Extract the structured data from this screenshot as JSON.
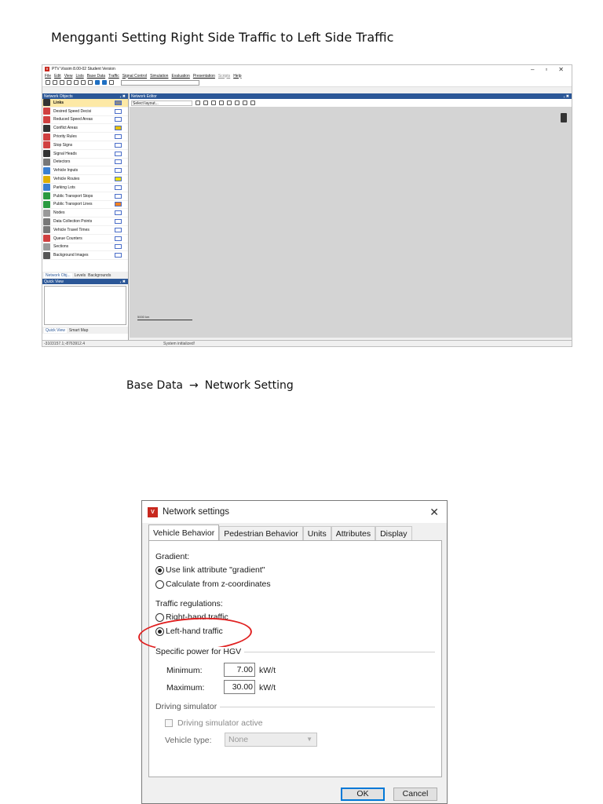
{
  "page": {
    "title": "Mengganti Setting Right Side Traffic to Left Side Traffic",
    "caption_left": "Base Data",
    "caption_arrow": "→",
    "caption_right": "Network Setting"
  },
  "vissim": {
    "window_title": "PTV Vissim 8.00-02 Student Version",
    "logo": "V",
    "window_controls": [
      "–",
      "▫",
      "✕"
    ],
    "menu": [
      "File",
      "Edit",
      "View",
      "Lists",
      "Base Data",
      "Traffic",
      "Signal Control",
      "Simulation",
      "Evaluation",
      "Presentation",
      "Scripts",
      "Help"
    ],
    "network_objects_title": "Network Objects",
    "pane_pin": "ₓ ✖",
    "network_objects": [
      {
        "label": "Links",
        "icon_color": "#333333",
        "swatch": "#888888",
        "selected": true
      },
      {
        "label": "Desired Speed Decisi",
        "icon_color": "#d04040",
        "swatch": "#ffffff"
      },
      {
        "label": "Reduced Speed Areas",
        "icon_color": "#d04040",
        "swatch": "#ffffff"
      },
      {
        "label": "Conflict Areas",
        "icon_color": "#333333",
        "swatch": "#e8c000"
      },
      {
        "label": "Priority Rules",
        "icon_color": "#d04040",
        "swatch": "#ffffff"
      },
      {
        "label": "Stop Signs",
        "icon_color": "#d04040",
        "swatch": "#ffffff"
      },
      {
        "label": "Signal Heads",
        "icon_color": "#333333",
        "swatch": "#ffffff"
      },
      {
        "label": "Detectors",
        "icon_color": "#777777",
        "swatch": "#ffffff"
      },
      {
        "label": "Vehicle Inputs",
        "icon_color": "#3a7fd0",
        "swatch": "#ffffff"
      },
      {
        "label": "Vehicle Routes",
        "icon_color": "#e0b000",
        "swatch": "#f0e000"
      },
      {
        "label": "Parking Lots",
        "icon_color": "#3a7fd0",
        "swatch": "#ffffff"
      },
      {
        "label": "Public Transport Stops",
        "icon_color": "#2a9a40",
        "swatch": "#ffffff"
      },
      {
        "label": "Public Transport Lines",
        "icon_color": "#2a9a40",
        "swatch": "#f08020"
      },
      {
        "label": "Nodes",
        "icon_color": "#999999",
        "swatch": "#ffffff"
      },
      {
        "label": "Data Collection Points",
        "icon_color": "#777777",
        "swatch": "#ffffff"
      },
      {
        "label": "Vehicle Travel Times",
        "icon_color": "#777777",
        "swatch": "#ffffff"
      },
      {
        "label": "Queue Counters",
        "icon_color": "#d04040",
        "swatch": "#ffffff"
      },
      {
        "label": "Sections",
        "icon_color": "#999999",
        "swatch": "#ffffff"
      },
      {
        "label": "Background Images",
        "icon_color": "#555555",
        "swatch": "#ffffff"
      }
    ],
    "left_tabs": [
      "Network Obj...",
      "Levels",
      "Backgrounds"
    ],
    "quick_view_title": "Quick View",
    "bottom_tabs": [
      "Quick View",
      "Smart Map"
    ],
    "editor_title": "Network Editor",
    "layout_select": "Select layout...",
    "scale_label": "5000 km",
    "status_coords": "-3103157.1;-8763912.4",
    "status_message": "System initialized!"
  },
  "dialog": {
    "title": "Network settings",
    "logo": "V",
    "close": "✕",
    "tabs": [
      "Vehicle Behavior",
      "Pedestrian Behavior",
      "Units",
      "Attributes",
      "Display"
    ],
    "active_tab": "Vehicle Behavior",
    "gradient_label": "Gradient:",
    "gradient_options": [
      {
        "label": "Use link attribute \"gradient\"",
        "checked": true
      },
      {
        "label": "Calculate from z-coordinates",
        "checked": false
      }
    ],
    "traffic_label": "Traffic regulations:",
    "traffic_options": [
      {
        "label": "Right-hand traffic",
        "checked": false
      },
      {
        "label": "Left-hand traffic",
        "checked": true
      }
    ],
    "hgv_label": "Specific power for HGV",
    "minimum_label": "Minimum:",
    "minimum_value": "7.00",
    "maximum_label": "Maximum:",
    "maximum_value": "30.00",
    "power_unit": "kW/t",
    "sim_label": "Driving simulator",
    "sim_checkbox": "Driving simulator active",
    "vehicle_type_label": "Vehicle type:",
    "vehicle_type_value": "None",
    "ok": "OK",
    "cancel": "Cancel"
  },
  "highlight_color": "#e02020"
}
